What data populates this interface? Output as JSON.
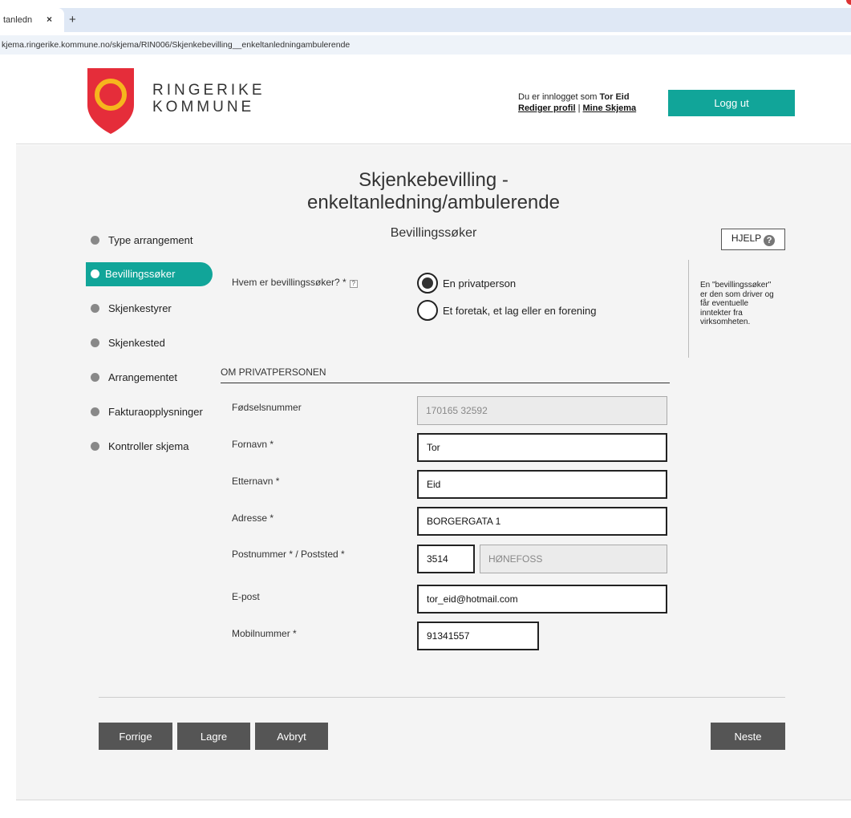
{
  "browser": {
    "tab_title": "tanledn",
    "tab_close": "×",
    "new_tab": "+",
    "url": "kjema.ringerike.kommune.no/skjema/RIN006/Skjenkebevilling__enkeltanledningambulerende"
  },
  "header": {
    "logo_line1": "RINGERIKE",
    "logo_line2": "KOMMUNE",
    "logged_in_prefix": "Du er innlogget som",
    "user_name": "Tor Eid",
    "edit_profile": "Rediger profil",
    "separator": "|",
    "my_forms": "Mine Skjema",
    "logout": "Logg ut",
    "colors": {
      "accent": "#11a599",
      "logo_red": "#e52d3a",
      "logo_yellow": "#f6b51d"
    }
  },
  "page": {
    "title_line1": "Skjenkebevilling -",
    "title_line2": "enkeltanledning/ambulerende",
    "subtitle": "Bevillingssøker",
    "help_button": "HJELP",
    "help_icon_glyph": "?",
    "help_text": "En \"bevillingssøker\" er den som driver og får eventuelle inntekter fra virksomheten."
  },
  "steps": [
    {
      "label": "Type arrangement",
      "active": false
    },
    {
      "label": "Bevillingssøker",
      "active": true
    },
    {
      "label": "Skjenkestyrer",
      "active": false
    },
    {
      "label": "Skjenkested",
      "active": false
    },
    {
      "label": "Arrangementet",
      "active": false
    },
    {
      "label": "Fakturaopplysninger",
      "active": false
    },
    {
      "label": "Kontroller skjema",
      "active": false
    }
  ],
  "form": {
    "question": "Hvem er bevillingssøker? *",
    "question_help_glyph": "?",
    "option_private": "En privatperson",
    "option_org": "Et foretak, et lag eller en forening",
    "selected": "En privatperson",
    "section_title": "OM PRIVATPERSONEN",
    "fields": {
      "birth_number": {
        "label": "Fødselsnummer",
        "value": "170165 32592"
      },
      "first_name": {
        "label": "Fornavn *",
        "value": "Tor"
      },
      "last_name": {
        "label": "Etternavn *",
        "value": "Eid"
      },
      "address": {
        "label": "Adresse *",
        "value": "BORGERGATA 1"
      },
      "postal": {
        "label": "Postnummer  * / Poststed *",
        "code": "3514",
        "place": "HØNEFOSS"
      },
      "email": {
        "label": "E-post",
        "value": "tor_eid@hotmail.com"
      },
      "mobile": {
        "label": "Mobilnummer *",
        "value": "91341557"
      }
    }
  },
  "buttons": {
    "prev": "Forrige",
    "save": "Lagre",
    "cancel": "Avbryt",
    "next": "Neste"
  }
}
